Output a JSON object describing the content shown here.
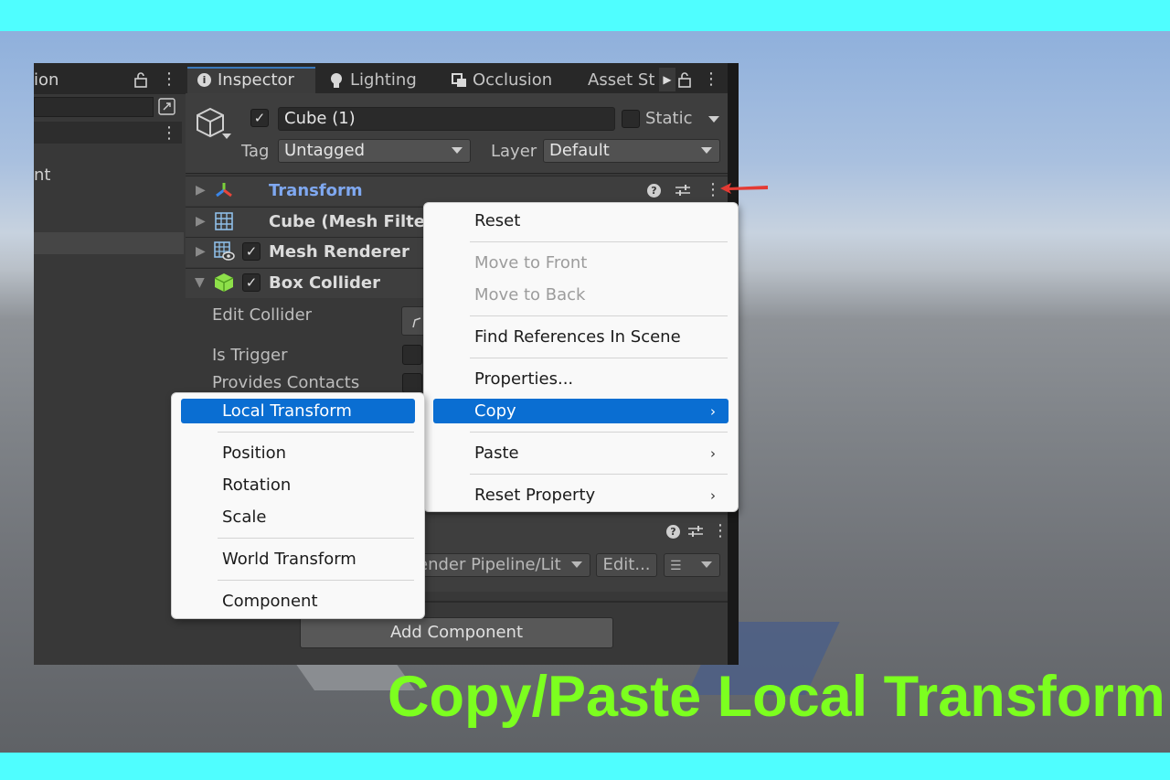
{
  "caption": "Copy/Paste Local Transform",
  "hierarchy": {
    "title_fragment": "ion",
    "item_fragment": "nt"
  },
  "tabs": [
    {
      "label": "Inspector"
    },
    {
      "label": "Lighting"
    },
    {
      "label": "Occlusion"
    },
    {
      "label": "Asset St"
    }
  ],
  "game_object": {
    "name": "Cube (1)",
    "static_label": "Static",
    "tag_label": "Tag",
    "tag_value": "Untagged",
    "layer_label": "Layer",
    "layer_value": "Default"
  },
  "components": [
    {
      "name": "Transform"
    },
    {
      "name": "Cube (Mesh Filter)"
    },
    {
      "name": "Mesh Renderer"
    },
    {
      "name": "Box Collider"
    }
  ],
  "box_collider": {
    "edit_collider_label": "Edit Collider",
    "is_trigger_label": "Is Trigger",
    "provides_contacts_label": "Provides Contacts"
  },
  "material": {
    "shader_value": "ender Pipeline/Lit",
    "edit_button": "Edit..."
  },
  "add_component_label": "Add Component",
  "context_menu": {
    "items": [
      "Reset",
      "Move to Front",
      "Move to Back",
      "Find References In Scene",
      "Properties...",
      "Copy",
      "Paste",
      "Reset Property"
    ]
  },
  "copy_submenu": {
    "items": [
      "Local Transform",
      "Position",
      "Rotation",
      "Scale",
      "World Transform",
      "Component"
    ]
  },
  "colors": {
    "accent_blue": "#0a6ed2",
    "caption_green": "#7cff1f",
    "transform_blue": "#7fa8f0",
    "band_cyan": "#4ffeff",
    "arrow_red": "#e43a33"
  }
}
